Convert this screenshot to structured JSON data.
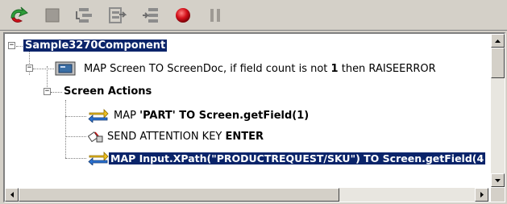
{
  "toolbar": {
    "buttons": [
      {
        "icon": "run-icon"
      },
      {
        "icon": "stop-icon"
      },
      {
        "icon": "step-over-icon"
      },
      {
        "icon": "step-into-icon"
      },
      {
        "icon": "step-out-icon"
      },
      {
        "icon": "breakpoint-icon"
      },
      {
        "icon": "pause-icon"
      }
    ]
  },
  "tree": {
    "root": {
      "label": "Sample3270Component"
    },
    "map_screen": {
      "prefix": "MAP Screen TO ScreenDoc, if field count is not ",
      "count": "1",
      "suffix": " then RAISEERROR"
    },
    "screen_actions": {
      "label": "Screen Actions"
    },
    "action_map_part": {
      "prefix": "MAP ",
      "value": "'PART' TO Screen.getField(1)"
    },
    "action_send_key": {
      "prefix": "SEND ATTENTION KEY ",
      "value": "ENTER"
    },
    "action_map_input": {
      "label": "MAP Input.XPath(\"PRODUCTREQUEST/SKU\") TO Screen.getField(4"
    }
  },
  "colors": {
    "selection": "#0a246a",
    "panel": "#d4d0c8",
    "run_green": "#2e9d3a",
    "breakpoint_red": "#d4111b"
  }
}
